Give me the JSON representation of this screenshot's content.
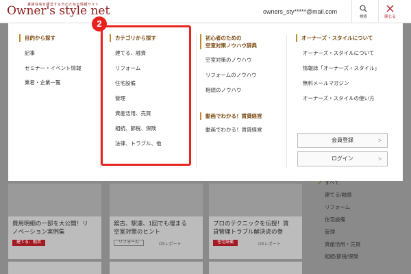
{
  "header": {
    "logo_tagline": "賃貸住宅を経営する方のための情報サイト",
    "logo": "Owner's style net",
    "email": "owners_sty*****@mail.com",
    "search_label": "検索",
    "close_label": "閉じる"
  },
  "menu": {
    "col1": {
      "heading": "目的から探す",
      "items": [
        "記事",
        "セミナー・イベント情報",
        "業者・企業一覧"
      ]
    },
    "col2": {
      "heading": "カテゴリから探す",
      "items": [
        "建てる、融資",
        "リフォーム",
        "住宅設備",
        "管理",
        "資産活用、売買",
        "相続、節税、保険",
        "法律、トラブル、他"
      ]
    },
    "col3": {
      "heading1_line1": "初心者のための",
      "heading1_line2": "空室対策ノウハウ辞典",
      "items1": [
        "空室対策のノウハウ",
        "リフォームのノウハウ",
        "相続のノウハウ"
      ],
      "heading2": "動画でわかる！賃貸経営",
      "items2": [
        "動画でわかる！賃貸経営"
      ]
    },
    "col4": {
      "heading": "オーナーズ・スタイルについて",
      "items": [
        "オーナーズ・スタイルについて",
        "情報誌「オーナーズ・スタイル」",
        "無料メールマガジン",
        "オーナーズ・スタイルの使い方"
      ],
      "register_label": "会員登録",
      "login_label": "ログイン"
    },
    "badge": "2"
  },
  "background": {
    "cards": [
      {
        "title_line1": "費用明細の一部を大公開！リ",
        "title_line2": "ノベーション実例集",
        "tag": "建てる、融資"
      },
      {
        "title_line1": "舘古、駅遠、1回でも埋まる",
        "title_line2": "空室対策のヒント",
        "tag": "リフォーム",
        "sub": "OSレポート"
      },
      {
        "title_line1": "プロのテクニックを伝授！賃",
        "title_line2": "貸管理トラブル解決虎の巻",
        "tag": "住宅設備",
        "sub": "OSレポート"
      }
    ],
    "side_items": [
      "すべて",
      "建てる/融資",
      "リフォーム",
      "住宅設備",
      "管理",
      "資産活用・売買",
      "相続/節税/保険"
    ]
  },
  "colors": {
    "accent_red": "#e8231f",
    "brand": "#8b1a1a",
    "heading_brown": "#7a4a10"
  }
}
